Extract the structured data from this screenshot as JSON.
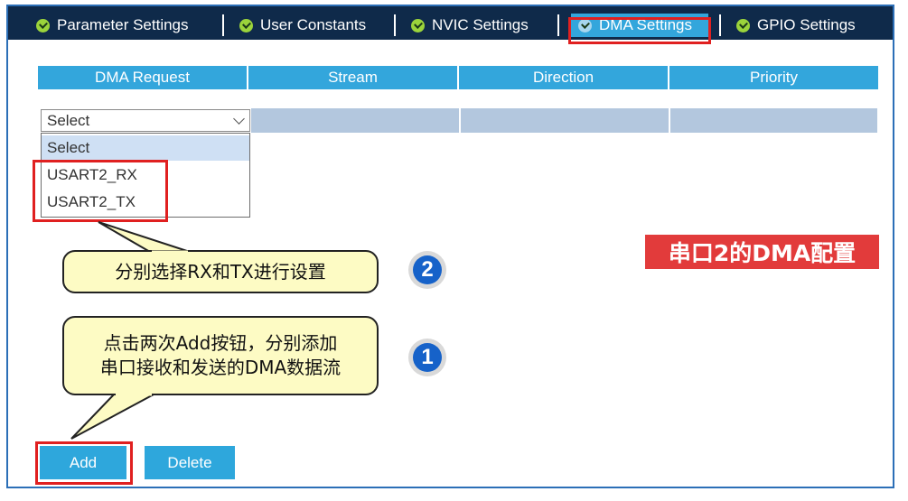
{
  "tabs": [
    {
      "label": "Parameter Settings",
      "active": false
    },
    {
      "label": "User Constants",
      "active": false
    },
    {
      "label": "NVIC Settings",
      "active": false
    },
    {
      "label": "DMA Settings",
      "active": true
    },
    {
      "label": "GPIO Settings",
      "active": false
    }
  ],
  "table": {
    "headers": [
      "DMA Request",
      "Stream",
      "Direction",
      "Priority"
    ]
  },
  "request_select": {
    "value": "Select",
    "options": [
      "Select",
      "USART2_RX",
      "USART2_TX"
    ]
  },
  "annotations": {
    "callout_2": "分别选择RX和TX进行设置",
    "callout_1_line1": "点击两次Add按钮，分别添加",
    "callout_1_line2": "串口接收和发送的DMA数据流",
    "badge_2": "2",
    "badge_1": "1",
    "title_label": "串口2的DMA配置"
  },
  "buttons": {
    "add": "Add",
    "delete": "Delete"
  },
  "colors": {
    "tab_bar": "#0f2a4a",
    "accent_blue": "#33a6dc",
    "highlight_red": "#e02020",
    "callout_yellow": "#fdfbc4"
  }
}
